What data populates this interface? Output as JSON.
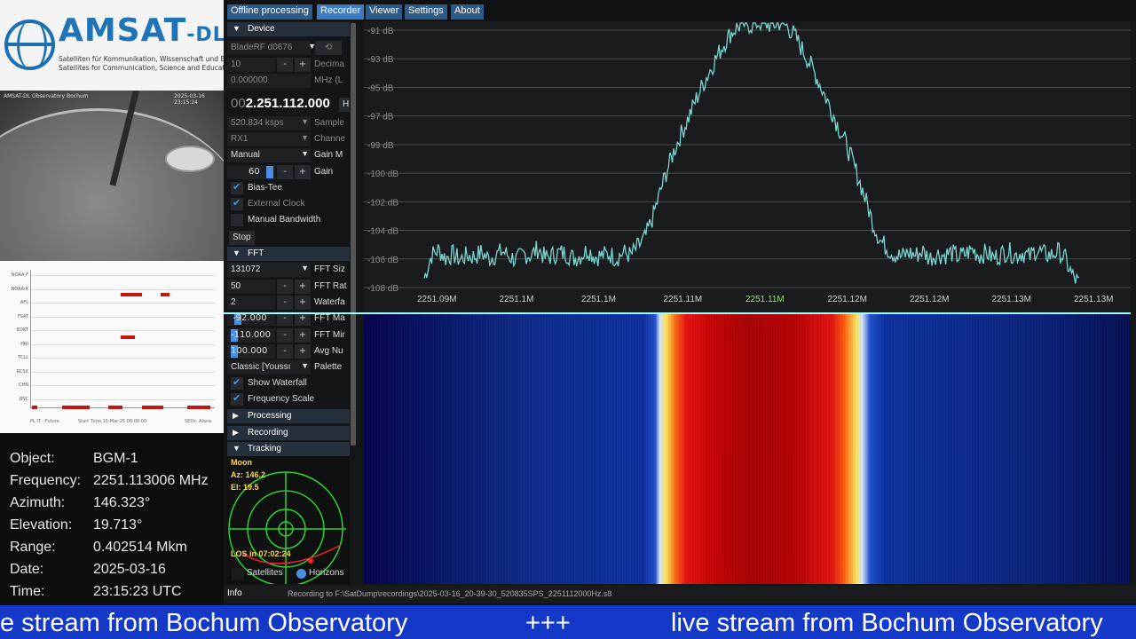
{
  "logo": {
    "title_main": "AMSAT",
    "title_suffix": "-DL",
    "subtitle_lines": [
      "Satelliten für Kommunikation, Wissenschaft und Bildung",
      "Satellites for Communication, Science and Education"
    ]
  },
  "camera": {
    "label_left": "AMSAT-DL Observatory Bochum",
    "label_right": "2025-03-16 23:15:24"
  },
  "schedule": {
    "rows": [
      "NOAA-F",
      "NOAA-K",
      "AFL",
      "FSAT",
      "EDKT",
      "HRI",
      "TCLL",
      "RCSX",
      "CHN",
      "BSC"
    ],
    "footer_left": "PL IT - Future",
    "footer_mid": "Start Time 15-Mar-25 08:00:00",
    "footer_right": "SEDs: Alone"
  },
  "info": [
    {
      "key": "Object:",
      "value": "BGM-1"
    },
    {
      "key": "Frequency:",
      "value": "2251.113006 MHz"
    },
    {
      "key": "Azimuth:",
      "value": "146.323°"
    },
    {
      "key": "Elevation:",
      "value": "19.713°"
    },
    {
      "key": "Range:",
      "value": "0.402514 Mkm"
    },
    {
      "key": "Date:",
      "value": "2025-03-16"
    },
    {
      "key": "Time:",
      "value": "23:15:23 UTC"
    }
  ],
  "menu": [
    "Offline processing",
    "Recorder",
    "Viewer",
    "Settings",
    "About"
  ],
  "device": {
    "header": "Device",
    "source": "BladeRF d0676",
    "decimation_value": "10",
    "decimation_label": "Decima",
    "offset_value": "0.000000",
    "offset_label": "MHz (L",
    "freq_prefix": "00",
    "freq_main": "2.251.112.000",
    "freq_unit": "H",
    "samplerate_value": "520.834 ksps",
    "samplerate_label": "Sample",
    "channel_value": "RX1",
    "channel_label": "Channe",
    "gainmode_value": "Manual",
    "gainmode_label": "Gain M",
    "gain_value": "60",
    "gain_label": "Gain",
    "biastee_label": "Bias-Tee",
    "extclock_label": "External Clock",
    "manualbw_label": "Manual Bandwidth",
    "stop_label": "Stop"
  },
  "fft": {
    "header": "FFT",
    "size_value": "131072",
    "size_label": "FFT Siz",
    "rate_value": "50",
    "rate_label": "FFT Rat",
    "waterfall_value": "2",
    "waterfall_label": "Waterfa",
    "max_value": "-92.000",
    "max_label": "FFT Ma",
    "min_value": "-110.000",
    "min_label": "FFT Mir",
    "avg_value": "100.000",
    "avg_label": "Avg Nu",
    "palette_value": "Classic [Youssı",
    "palette_label": "Palette",
    "show_waterfall": "Show Waterfall",
    "freq_scale": "Frequency Scale"
  },
  "sections": {
    "processing": "Processing",
    "recording": "Recording",
    "tracking": "Tracking"
  },
  "tracking": {
    "object": "Moon",
    "az": "Az: 146.2",
    "el": "El: 19.5",
    "los": "LOS in 07:02:24",
    "satellites_label": "Satellites",
    "horizons_label": "Horizons"
  },
  "infobar": {
    "label": "Info",
    "recording": "Recording to F:\\SatDump\\recordings\\2025-03-16_20-39-30_520835SPS_2251112000Hz.s8"
  },
  "chart_data": {
    "type": "line",
    "y_ticks": [
      "-91 dB",
      "-93 dB",
      "-95 dB",
      "-97 dB",
      "-99 dB",
      "-100 dB",
      "-102 dB",
      "-104 dB",
      "-106 dB",
      "-108 dB"
    ],
    "x_ticks": [
      "2251.09M",
      "2251.1M",
      "2251.1M",
      "2251.11M",
      "2251.11M",
      "2251.12M",
      "2251.12M",
      "2251.13M",
      "2251.13M"
    ],
    "center_tick_index": 4,
    "ylim": [
      -109,
      -91
    ],
    "series_color": "#7ad3cf",
    "series": [
      {
        "values": [
          -108.6,
          -107.0,
          -106.6,
          -107.2,
          -106.9,
          -107.3,
          -107.0,
          -107.1,
          -106.8,
          -107.2,
          -107.0,
          -106.7,
          -107.1,
          -107.3,
          -106.9,
          -107.0,
          -106.5,
          -107.2,
          -107.0,
          -106.8,
          -106.9,
          -107.2,
          -107.0,
          -106.6,
          -107.1,
          -107.0,
          -106.9,
          -107.2,
          -106.8,
          -107.0,
          -106.4,
          -105.8,
          -104.5,
          -102.8,
          -101.2,
          -99.8,
          -98.6,
          -97.5,
          -96.3,
          -95.2,
          -94.2,
          -93.2,
          -92.3,
          -91.5,
          -91.0,
          -90.8,
          -90.9,
          -90.7,
          -90.8,
          -90.9,
          -90.7,
          -91.0,
          -91.6,
          -92.5,
          -93.4,
          -94.4,
          -95.5,
          -96.6,
          -97.8,
          -98.9,
          -100.2,
          -101.6,
          -103.1,
          -104.7,
          -105.9,
          -106.5,
          -106.9,
          -107.1,
          -106.8,
          -107.0,
          -106.7,
          -107.2,
          -106.9,
          -107.0,
          -106.8,
          -107.1,
          -106.9,
          -106.6,
          -107.0,
          -106.8,
          -107.2,
          -106.9,
          -106.7,
          -107.0,
          -106.8,
          -107.1,
          -106.6,
          -106.9,
          -107.0,
          -106.7,
          -107.2,
          -108.4,
          -109.0
        ]
      }
    ]
  },
  "ticker": {
    "text1": "e stream from Bochum Observatory",
    "sep": "+++",
    "text2": "live stream from Bochum Observatory"
  }
}
